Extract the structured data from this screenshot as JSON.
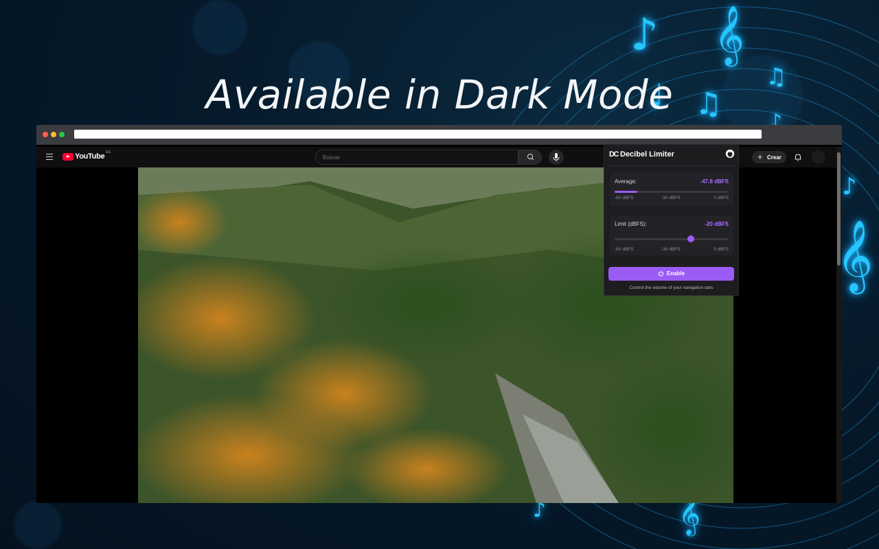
{
  "hero": {
    "title": "Available in Dark Mode"
  },
  "browser": {
    "traffic_lights": {
      "close": "#ff5f57",
      "minimize": "#febc2e",
      "maximize": "#28c840"
    }
  },
  "youtube": {
    "logo_text": "YouTube",
    "region": "ES",
    "search_placeholder": "Buscar",
    "create_label": "Crear",
    "icons": [
      "menu-icon",
      "search-icon",
      "mic-icon",
      "plus-icon",
      "bell-icon"
    ]
  },
  "extension": {
    "logo": "DC",
    "title": "Decibel Limiter",
    "average": {
      "label": "Average:",
      "value": "-47.8 dBFS",
      "level_fraction": 0.2,
      "ticks": [
        "-60 dBFS",
        "-30 dBFS",
        "0 dBFS"
      ]
    },
    "limit": {
      "label": "Limit (dBFS):",
      "value": "-20 dBFS",
      "slider_fraction": 0.667,
      "ticks": [
        "-60 dBFS",
        "-30 dBFS",
        "0 dBFS"
      ]
    },
    "enable_label": "Enable",
    "footer": "Control the volume of your navigation tabs",
    "accent_color": "#9b5cf6"
  }
}
